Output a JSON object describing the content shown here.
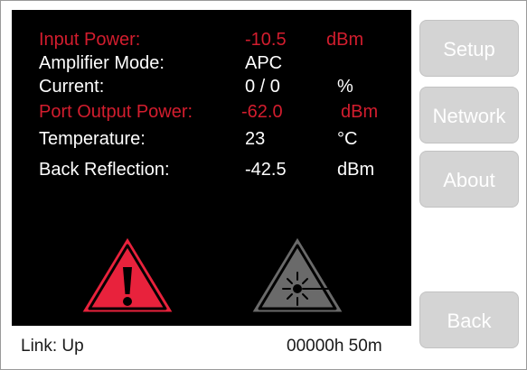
{
  "readings": [
    {
      "label": "Input Power:",
      "value": "-10.5",
      "unit": "dBm",
      "color": "#d31d2e"
    },
    {
      "label": "Amplifier Mode:",
      "value": "APC",
      "unit": "",
      "color": "#ffffff"
    },
    {
      "label": "Current:",
      "value": "0 / 0",
      "unit": "%",
      "color": "#ffffff"
    },
    {
      "label": "Port Output Power:",
      "value": "-62.0",
      "unit": "dBm",
      "color": "#d31d2e"
    },
    {
      "label": "Temperature:",
      "value": "23",
      "unit": "°C",
      "color": "#ffffff"
    },
    {
      "label": "Back Reflection:",
      "value": "-42.5",
      "unit": "dBm",
      "color": "#ffffff"
    }
  ],
  "buttons": {
    "setup": "Setup",
    "network": "Network",
    "about": "About",
    "back": "Back"
  },
  "status": {
    "link": "Link: Up",
    "uptime": "00000h 50m"
  },
  "icons": {
    "general_warning": "warning-triangle-icon",
    "laser_warning": "laser-warning-icon"
  },
  "colors": {
    "alarm_red": "#d31d2e",
    "warning_fill": "#e8223c",
    "laser_inactive": "#6a6a6a",
    "button_bg": "#d4d4d4"
  }
}
